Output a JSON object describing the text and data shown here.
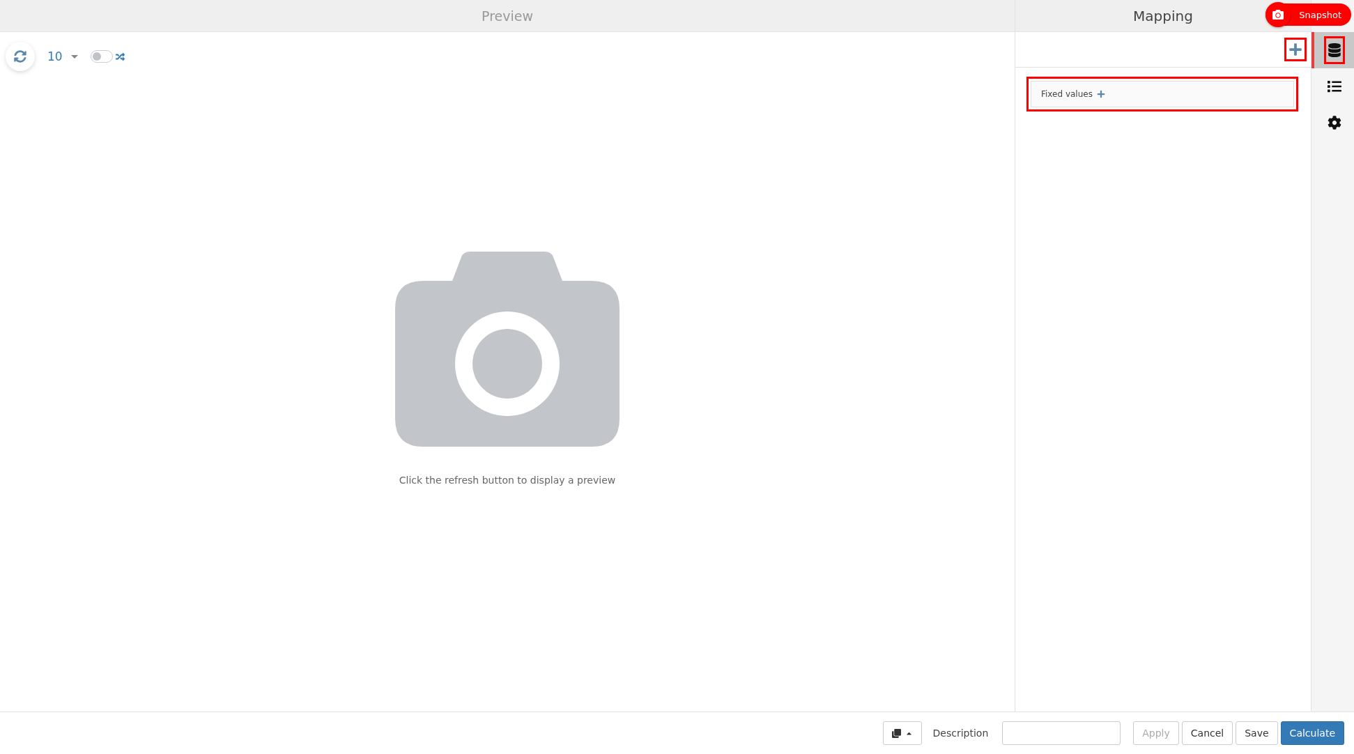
{
  "preview": {
    "title": "Preview",
    "row_count": "10",
    "shuffle_on": false,
    "message": "Click the refresh button to display a preview"
  },
  "mapping": {
    "title": "Mapping",
    "snapshot_button": "Snapshot",
    "fixed_values": "Fixed values"
  },
  "sidebar": {
    "items": [
      {
        "kind": "database",
        "selected": true
      },
      {
        "kind": "list",
        "selected": false
      },
      {
        "kind": "settings",
        "selected": false
      }
    ]
  },
  "footer": {
    "description_label": "Description",
    "buttons": [
      {
        "label": "Apply",
        "disabled": true,
        "primary": false
      },
      {
        "label": "Cancel",
        "disabled": false,
        "primary": false
      },
      {
        "label": "Save",
        "disabled": false,
        "primary": false
      },
      {
        "label": "Calculate",
        "disabled": false,
        "primary": true
      }
    ]
  }
}
